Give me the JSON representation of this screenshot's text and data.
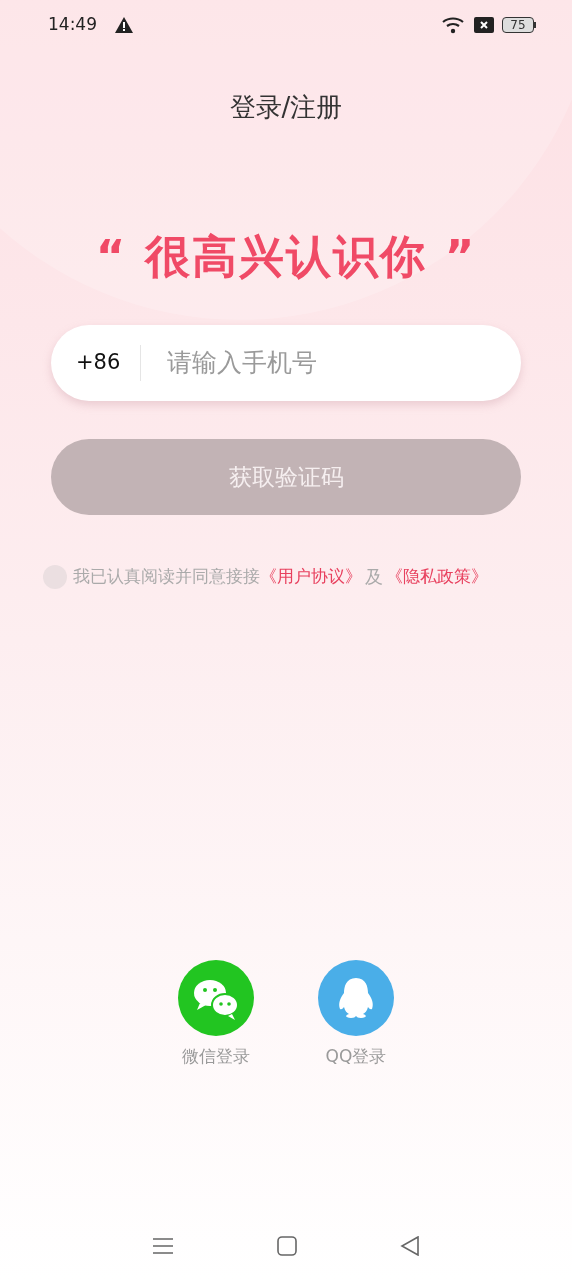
{
  "status_bar": {
    "time": "14:49",
    "battery": "75"
  },
  "title": "登录/注册",
  "slogan": "“ 很高兴认识你 ”",
  "phone_field": {
    "country_code": "+86",
    "placeholder": "请输入手机号"
  },
  "get_code_button": {
    "label": "获取验证码",
    "disabled": true
  },
  "agreement": {
    "checked": false,
    "text": "我已认真阅读并同意接接",
    "links": [
      {
        "kind": "link",
        "text": "《用户协议》"
      },
      {
        "kind": "plain",
        "text": "及"
      },
      {
        "kind": "link",
        "text": "《隐私政策》"
      }
    ]
  },
  "social_logins": [
    {
      "kind": "wechat",
      "label": "微信登录"
    },
    {
      "kind": "qq",
      "label": "QQ登录"
    }
  ]
}
